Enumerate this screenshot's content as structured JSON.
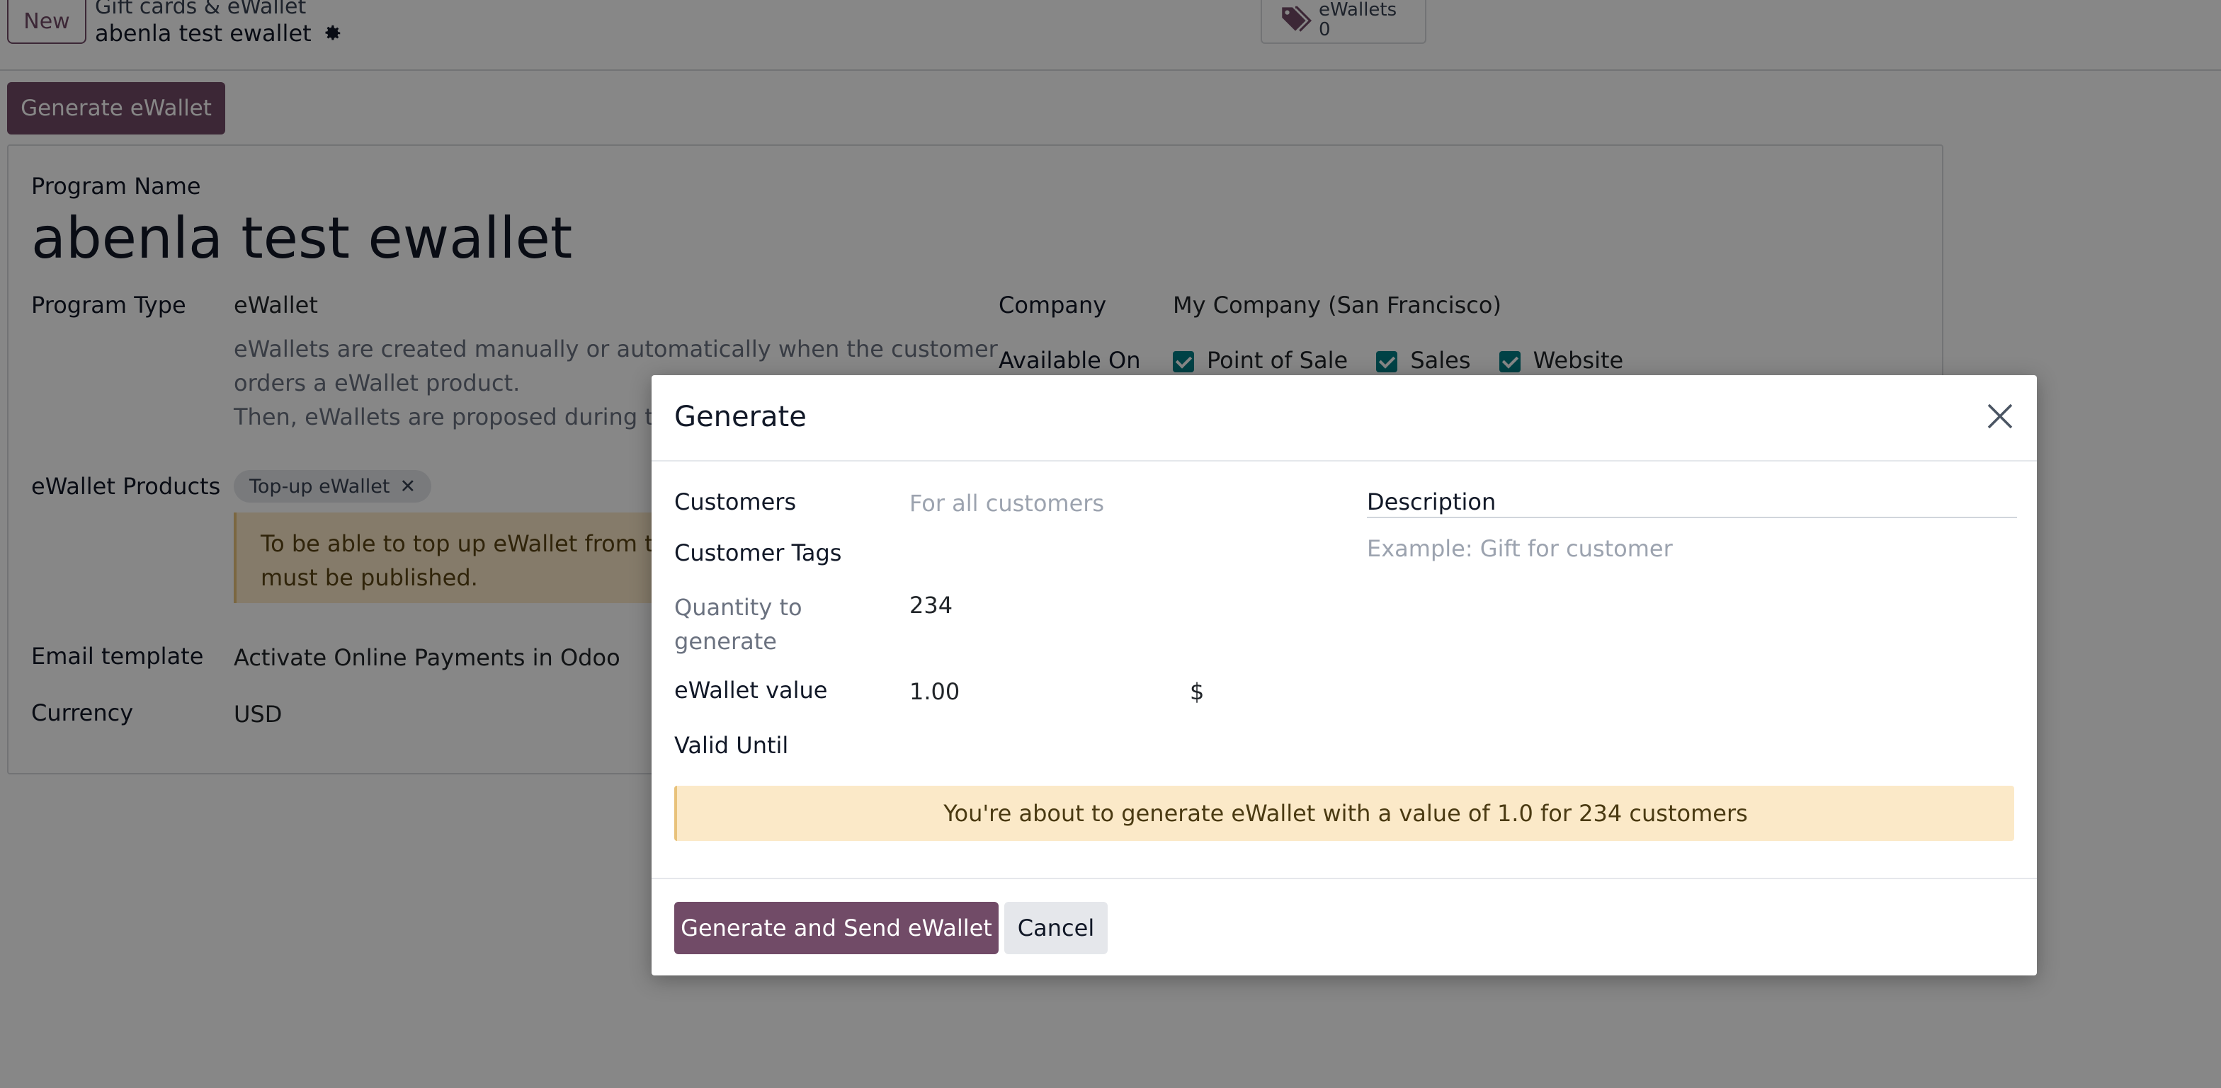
{
  "header": {
    "new_label": "New",
    "breadcrumb_parent": "Gift cards & eWallet",
    "breadcrumb_current": "abenla test ewallet",
    "smart_button": {
      "label": "eWallets",
      "count": "0",
      "icon": "tags-icon"
    }
  },
  "actions": {
    "generate_label": "Generate eWallet"
  },
  "form": {
    "program_name_label": "Program Name",
    "program_name": "abenla test ewallet",
    "program_type_label": "Program Type",
    "program_type": "eWallet",
    "program_type_help_1": "eWallets are created manually or automatically when the customer",
    "program_type_help_2": "orders a eWallet product.",
    "program_type_help_3": "Then, eWallets are proposed during the",
    "company_label": "Company",
    "company": "My Company (San Francisco)",
    "available_on_label": "Available On",
    "available_on": [
      "Point of Sale",
      "Sales",
      "Website"
    ],
    "products_label": "eWallet Products",
    "product_tag": "Top-up eWallet",
    "warning_1": "To be able to top up eWallet from the",
    "warning_2": "must be published.",
    "email_template_label": "Email template",
    "email_template": "Activate Online Payments in Odoo",
    "currency_label": "Currency",
    "currency": "USD"
  },
  "modal": {
    "title": "Generate",
    "customers_label": "Customers",
    "customers_placeholder": "For all customers",
    "customer_tags_label": "Customer Tags",
    "quantity_label_1": "Quantity to",
    "quantity_label_2": "generate",
    "quantity_value": "234",
    "value_label": "eWallet value",
    "value_amount": "1.00",
    "value_currency": "$",
    "valid_until_label": "Valid Until",
    "description_label": "Description",
    "description_placeholder": "Example: Gift for customer",
    "alert_text": "You're about to generate eWallet with a value of 1.0 for 234 customers",
    "primary_button": "Generate and Send eWallet",
    "cancel_button": "Cancel"
  },
  "colors": {
    "brand": "#714b67",
    "checkbox": "#017e84",
    "alert_bg": "#fbe9c8"
  }
}
